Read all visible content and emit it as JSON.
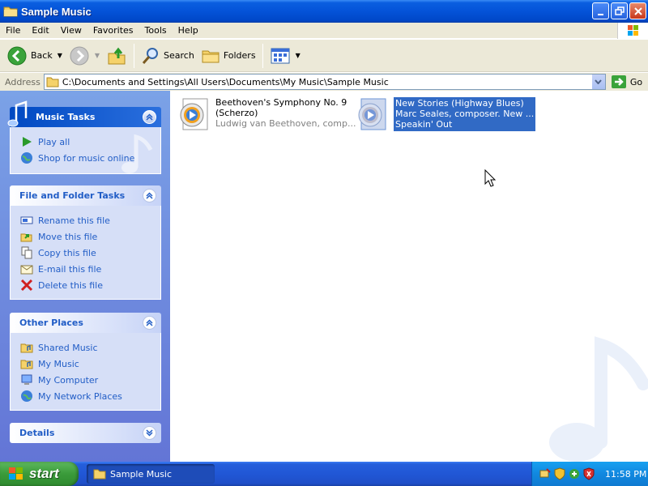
{
  "window": {
    "title": "Sample Music"
  },
  "menu": [
    "File",
    "Edit",
    "View",
    "Favorites",
    "Tools",
    "Help"
  ],
  "toolbar": {
    "back": "Back",
    "search": "Search",
    "folders": "Folders"
  },
  "address": {
    "label": "Address",
    "path": "C:\\Documents and Settings\\All Users\\Documents\\My Music\\Sample Music",
    "go": "Go"
  },
  "panels": {
    "music_tasks": {
      "title": "Music Tasks",
      "items": [
        "Play all",
        "Shop for music online"
      ]
    },
    "file_tasks": {
      "title": "File and Folder Tasks",
      "items": [
        "Rename this file",
        "Move this file",
        "Copy this file",
        "E-mail this file",
        "Delete this file"
      ]
    },
    "other_places": {
      "title": "Other Places",
      "items": [
        "Shared Music",
        "My Music",
        "My Computer",
        "My Network Places"
      ]
    },
    "details": {
      "title": "Details"
    }
  },
  "files": [
    {
      "line1": "Beethoven's Symphony No. 9",
      "line2": "(Scherzo)",
      "line3": "Ludwig van Beethoven, comp..."
    },
    {
      "line1": "New Stories (Highway Blues)",
      "line2": "Marc Seales, composer. New ...",
      "line3": "Speakin' Out"
    }
  ],
  "taskbar": {
    "start": "start",
    "task": "Sample Music",
    "clock": "11:58 PM"
  },
  "colors": {
    "accent": "#215dc6",
    "selection": "#316ac5",
    "taskbar": "#245edb"
  }
}
